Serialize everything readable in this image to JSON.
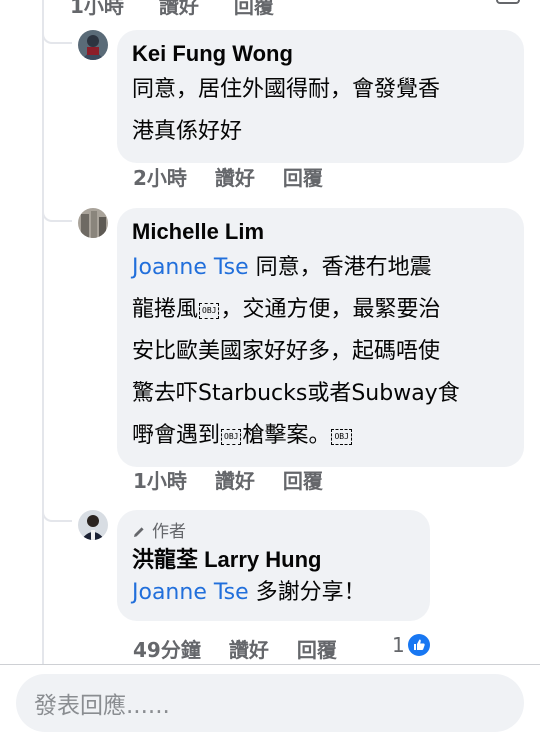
{
  "top_partial": {
    "labels": [
      "1小時",
      "讚好",
      "回覆"
    ]
  },
  "comments": [
    {
      "name": "Kei Fung Wong",
      "lines": [
        "同意，居住外國得耐，會發覺香",
        "港真係好好"
      ],
      "time": "2小時",
      "like_label": "讚好",
      "reply_label": "回覆"
    },
    {
      "name": "Michelle Lim",
      "mention": "Joanne Tse",
      "line1_rest": " 同意，香港冇地震",
      "line2a": "龍捲風",
      "line2b": "，交通方便，最緊要治",
      "line3": "安比歐美國家好好多，起碼唔使",
      "line4": "驚去吓Starbucks或者Subway食",
      "line5a": "嘢會遇到",
      "line5b": "槍擊案。",
      "obj_label": "OBJ",
      "time": "1小時",
      "like_label": "讚好",
      "reply_label": "回覆"
    },
    {
      "author_badge": "作者",
      "name": "洪龍荃 Larry Hung",
      "mention": "Joanne Tse",
      "text_rest": " 多謝分享！",
      "time": "49分鐘",
      "like_label": "讚好",
      "reply_label": "回覆",
      "reaction_count": "1"
    }
  ],
  "composer": {
    "placeholder": "發表回應......"
  },
  "colors": {
    "bubble": "#f0f2f5",
    "mention": "#216fdb",
    "meta": "#65676b",
    "like": "#1877f2"
  }
}
